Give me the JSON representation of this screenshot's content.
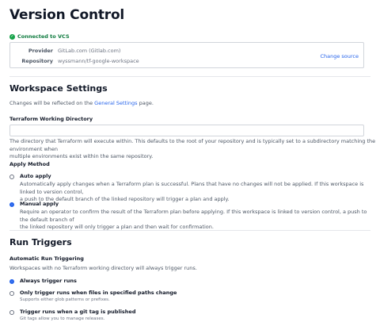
{
  "page_title": "Version Control",
  "vcs": {
    "status": "Connected to VCS",
    "provider_label": "Provider",
    "provider_value": "GitLab.com (Gitlab.com)",
    "repository_label": "Repository",
    "repository_value": "wyssmann/tf-google-workspace",
    "change_source": "Change source"
  },
  "workspace_settings": {
    "title": "Workspace Settings",
    "changes_prefix": "Changes will be reflected on the ",
    "general_settings_link": "General Settings",
    "changes_suffix": " page.",
    "working_dir_label": "Terraform Working Directory",
    "working_dir_value": "",
    "working_dir_help_1": "The directory that Terraform will execute within. This defaults to the root of your repository and is typically set to a subdirectory matching the environment when",
    "working_dir_help_2": "multiple environments exist within the same repository.",
    "apply_method_label": "Apply Method",
    "auto_apply": {
      "title": "Auto apply",
      "desc_1": "Automatically apply changes when a Terraform plan is successful. Plans that have no changes will not be applied. If this workspace is linked to version control,",
      "desc_2": "a push to the default branch of the linked repository will trigger a plan and apply."
    },
    "manual_apply": {
      "title": "Manual apply",
      "desc_1": "Require an operator to confirm the result of the Terraform plan before applying. If this workspace is linked to version control, a push to the default branch of",
      "desc_2": "the linked repository will only trigger a plan and then wait for confirmation."
    },
    "selected_apply": "manual"
  },
  "run_triggers": {
    "title": "Run Triggers",
    "auto_label": "Automatic Run Triggering",
    "auto_desc": "Workspaces with no Terraform working directory will always trigger runs.",
    "options": [
      {
        "title": "Always trigger runs",
        "hint": ""
      },
      {
        "title": "Only trigger runs when files in specified paths change",
        "hint": "Supports either glob patterns or prefixes."
      },
      {
        "title": "Trigger runs when a git tag is published",
        "hint": "Git tags allow you to manage releases."
      }
    ],
    "selected": 0
  },
  "colors": {
    "accent": "#2563eb",
    "success": "#17a34a"
  }
}
